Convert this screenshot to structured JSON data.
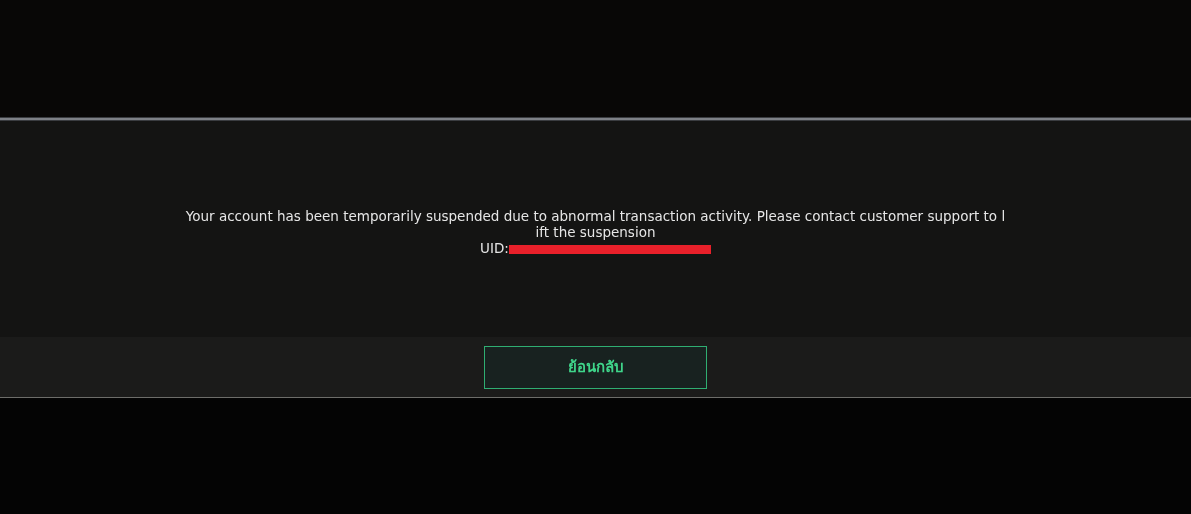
{
  "dialog": {
    "message_lines": [
      "Your account has been temporarily suspended due to abnormal transaction activity. Please contact customer support to l",
      "ift the suspension"
    ],
    "uid_label": "UID:"
  },
  "button": {
    "label": "ย้อนกลับ"
  }
}
